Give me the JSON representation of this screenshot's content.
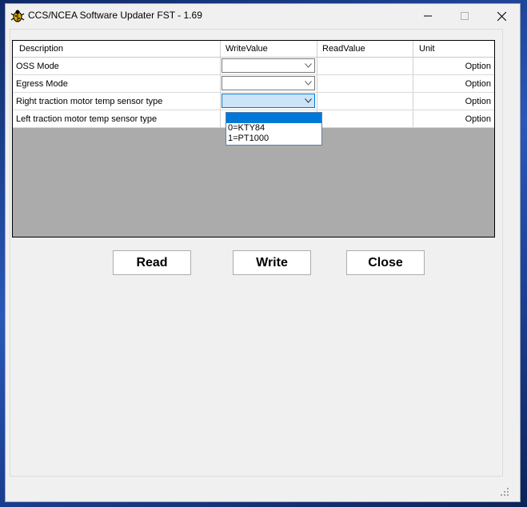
{
  "window": {
    "title": "CCS/NCEA Software Updater FST - 1.69"
  },
  "columns": [
    "Description",
    "WriteValue",
    "ReadValue",
    "Unit"
  ],
  "rows": [
    {
      "description": "OSS Mode",
      "write_value": "",
      "read_value": "",
      "unit": "Option"
    },
    {
      "description": "Egress Mode",
      "write_value": "",
      "read_value": "",
      "unit": "Option"
    },
    {
      "description": "Right traction motor temp sensor type",
      "write_value": "",
      "read_value": "",
      "unit": "Option"
    },
    {
      "description": "Left traction motor temp sensor type",
      "write_value": "",
      "read_value": "",
      "unit": "Option"
    }
  ],
  "dropdown": {
    "options": [
      "",
      "0=KTY84",
      "1=PT1000"
    ],
    "selected_index": 0
  },
  "buttons": {
    "read": "Read",
    "write": "Write",
    "close": "Close"
  },
  "colors": {
    "grid_background": "#ababab",
    "selection": "#0078d7",
    "focused_combo": "#cce4f7"
  }
}
